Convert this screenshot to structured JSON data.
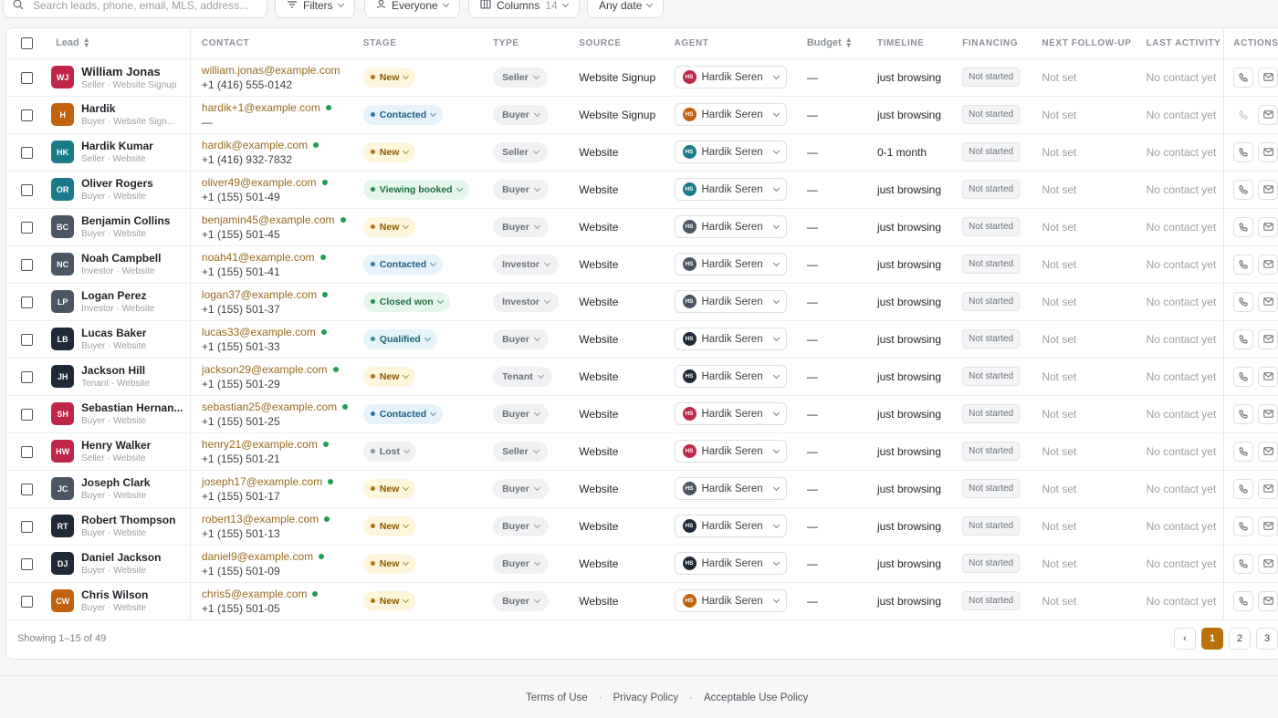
{
  "toolbar": {
    "search_placeholder": "Search leads, phone, email, MLS, address...",
    "filters_label": "Filters",
    "everyone_label": "Everyone",
    "columns_label": "Columns",
    "columns_count": "14",
    "date_label": "Any date"
  },
  "columns": {
    "lead": "Lead",
    "contact": "CONTACT",
    "stage": "STAGE",
    "type": "TYPE",
    "source": "SOURCE",
    "agent": "AGENT",
    "budget": "Budget",
    "timeline": "TIMELINE",
    "financing": "FINANCING",
    "next_followup": "NEXT FOLLOW-UP",
    "last_activity": "LAST ACTIVITY",
    "actions": "ACTIONS"
  },
  "stage_colors": {
    "New": {
      "bg": "#fdf6dc",
      "fg": "#8a5a00",
      "dot": "#b8720c"
    },
    "Contacted": {
      "bg": "#e6f3fb",
      "fg": "#1d5f86",
      "dot": "#2b7bb0"
    },
    "Viewing booked": {
      "bg": "#e5f6ec",
      "fg": "#1f6e42",
      "dot": "#22914f"
    },
    "Closed won": {
      "bg": "#e5f6ec",
      "fg": "#1f6e42",
      "dot": "#22914f"
    },
    "Qualified": {
      "bg": "#e3f5f8",
      "fg": "#1b6473",
      "dot": "#2b8fa3"
    },
    "Lost": {
      "bg": "#f0f1f3",
      "fg": "#6b7178",
      "dot": "#8a9099"
    }
  },
  "rows": [
    {
      "initials": "WJ",
      "avatar_color": "#c0264a",
      "name": "William Jonas",
      "sub": "Seller · Website Signup",
      "email": "william.jonas@example.com",
      "phone": "+1 (416) 555-0142",
      "verified": false,
      "stage": "New",
      "type": "Seller",
      "source": "Website Signup",
      "agent": "Hardik Seren",
      "agent_color": "#c0264a",
      "budget": "—",
      "timeline": "just browsing",
      "financing": "Not started",
      "followup": "Not set",
      "last": "No contact yet",
      "call_enabled": true
    },
    {
      "initials": "H",
      "avatar_color": "#c2620f",
      "name": "Hardik",
      "sub": "Buyer · Website Sign...",
      "email": "hardik+1@example.com",
      "phone": "—",
      "verified": true,
      "stage": "Contacted",
      "type": "Buyer",
      "source": "Website Signup",
      "agent": "Hardik Seren",
      "agent_color": "#c2620f",
      "budget": "—",
      "timeline": "just browsing",
      "financing": "Not started",
      "followup": "Not set",
      "last": "No contact yet",
      "call_enabled": false
    },
    {
      "initials": "HK",
      "avatar_color": "#1a7a8a",
      "name": "Hardik Kumar",
      "sub": "Seller · Website",
      "email": "hardik@example.com",
      "phone": "+1 (416) 932-7832",
      "verified": true,
      "stage": "New",
      "type": "Seller",
      "source": "Website",
      "agent": "Hardik Seren",
      "agent_color": "#1a7a8a",
      "budget": "—",
      "timeline": "0-1 month",
      "financing": "Not started",
      "followup": "Not set",
      "last": "No contact yet",
      "call_enabled": true
    },
    {
      "initials": "OR",
      "avatar_color": "#1a7a8a",
      "name": "Oliver Rogers",
      "sub": "Buyer · Website",
      "email": "oliver49@example.com",
      "phone": "+1 (155) 501-49",
      "verified": true,
      "stage": "Viewing booked",
      "type": "Buyer",
      "source": "Website",
      "agent": "Hardik Seren",
      "agent_color": "#1a7a8a",
      "budget": "—",
      "timeline": "just browsing",
      "financing": "Not started",
      "followup": "Not set",
      "last": "No contact yet",
      "call_enabled": true
    },
    {
      "initials": "BC",
      "avatar_color": "#4b5563",
      "name": "Benjamin Collins",
      "sub": "Buyer · Website",
      "email": "benjamin45@example.com",
      "phone": "+1 (155) 501-45",
      "verified": true,
      "stage": "New",
      "type": "Buyer",
      "source": "Website",
      "agent": "Hardik Seren",
      "agent_color": "#4b5563",
      "budget": "—",
      "timeline": "just browsing",
      "financing": "Not started",
      "followup": "Not set",
      "last": "No contact yet",
      "call_enabled": true
    },
    {
      "initials": "NC",
      "avatar_color": "#4b5563",
      "name": "Noah Campbell",
      "sub": "Investor · Website",
      "email": "noah41@example.com",
      "phone": "+1 (155) 501-41",
      "verified": true,
      "stage": "Contacted",
      "type": "Investor",
      "source": "Website",
      "agent": "Hardik Seren",
      "agent_color": "#4b5563",
      "budget": "—",
      "timeline": "just browsing",
      "financing": "Not started",
      "followup": "Not set",
      "last": "No contact yet",
      "call_enabled": true
    },
    {
      "initials": "LP",
      "avatar_color": "#4b5563",
      "name": "Logan Perez",
      "sub": "Investor · Website",
      "email": "logan37@example.com",
      "phone": "+1 (155) 501-37",
      "verified": true,
      "stage": "Closed won",
      "type": "Investor",
      "source": "Website",
      "agent": "Hardik Seren",
      "agent_color": "#4b5563",
      "budget": "—",
      "timeline": "just browsing",
      "financing": "Not started",
      "followup": "Not set",
      "last": "No contact yet",
      "call_enabled": true
    },
    {
      "initials": "LB",
      "avatar_color": "#1f2937",
      "name": "Lucas Baker",
      "sub": "Buyer · Website",
      "email": "lucas33@example.com",
      "phone": "+1 (155) 501-33",
      "verified": true,
      "stage": "Qualified",
      "type": "Buyer",
      "source": "Website",
      "agent": "Hardik Seren",
      "agent_color": "#1f2937",
      "budget": "—",
      "timeline": "just browsing",
      "financing": "Not started",
      "followup": "Not set",
      "last": "No contact yet",
      "call_enabled": true
    },
    {
      "initials": "JH",
      "avatar_color": "#1f2937",
      "name": "Jackson Hill",
      "sub": "Tenant · Website",
      "email": "jackson29@example.com",
      "phone": "+1 (155) 501-29",
      "verified": true,
      "stage": "New",
      "type": "Tenant",
      "source": "Website",
      "agent": "Hardik Seren",
      "agent_color": "#1f2937",
      "budget": "—",
      "timeline": "just browsing",
      "financing": "Not started",
      "followup": "Not set",
      "last": "No contact yet",
      "call_enabled": true
    },
    {
      "initials": "SH",
      "avatar_color": "#c0264a",
      "name": "Sebastian Hernan...",
      "sub": "Buyer · Website",
      "email": "sebastian25@example.com",
      "phone": "+1 (155) 501-25",
      "verified": true,
      "stage": "Contacted",
      "type": "Buyer",
      "source": "Website",
      "agent": "Hardik Seren",
      "agent_color": "#c0264a",
      "budget": "—",
      "timeline": "just browsing",
      "financing": "Not started",
      "followup": "Not set",
      "last": "No contact yet",
      "call_enabled": true
    },
    {
      "initials": "HW",
      "avatar_color": "#c0264a",
      "name": "Henry Walker",
      "sub": "Seller · Website",
      "email": "henry21@example.com",
      "phone": "+1 (155) 501-21",
      "verified": true,
      "stage": "Lost",
      "type": "Seller",
      "source": "Website",
      "agent": "Hardik Seren",
      "agent_color": "#c0264a",
      "budget": "—",
      "timeline": "just browsing",
      "financing": "Not started",
      "followup": "Not set",
      "last": "No contact yet",
      "call_enabled": true
    },
    {
      "initials": "JC",
      "avatar_color": "#4b5563",
      "name": "Joseph Clark",
      "sub": "Buyer · Website",
      "email": "joseph17@example.com",
      "phone": "+1 (155) 501-17",
      "verified": true,
      "stage": "New",
      "type": "Buyer",
      "source": "Website",
      "agent": "Hardik Seren",
      "agent_color": "#4b5563",
      "budget": "—",
      "timeline": "just browsing",
      "financing": "Not started",
      "followup": "Not set",
      "last": "No contact yet",
      "call_enabled": true
    },
    {
      "initials": "RT",
      "avatar_color": "#1f2937",
      "name": "Robert Thompson",
      "sub": "Buyer · Website",
      "email": "robert13@example.com",
      "phone": "+1 (155) 501-13",
      "verified": true,
      "stage": "New",
      "type": "Buyer",
      "source": "Website",
      "agent": "Hardik Seren",
      "agent_color": "#1f2937",
      "budget": "—",
      "timeline": "just browsing",
      "financing": "Not started",
      "followup": "Not set",
      "last": "No contact yet",
      "call_enabled": true
    },
    {
      "initials": "DJ",
      "avatar_color": "#1f2937",
      "name": "Daniel Jackson",
      "sub": "Buyer · Website",
      "email": "daniel9@example.com",
      "phone": "+1 (155) 501-09",
      "verified": true,
      "stage": "New",
      "type": "Buyer",
      "source": "Website",
      "agent": "Hardik Seren",
      "agent_color": "#1f2937",
      "budget": "—",
      "timeline": "just browsing",
      "financing": "Not started",
      "followup": "Not set",
      "last": "No contact yet",
      "call_enabled": true
    },
    {
      "initials": "CW",
      "avatar_color": "#c2620f",
      "name": "Chris Wilson",
      "sub": "Buyer · Website",
      "email": "chris5@example.com",
      "phone": "+1 (155) 501-05",
      "verified": true,
      "stage": "New",
      "type": "Buyer",
      "source": "Website",
      "agent": "Hardik Seren",
      "agent_color": "#c2620f",
      "budget": "—",
      "timeline": "just browsing",
      "financing": "Not started",
      "followup": "Not set",
      "last": "No contact yet",
      "call_enabled": true
    }
  ],
  "agent_initials": "HS",
  "pagination": {
    "showing": "Showing 1–15 of 49",
    "prev": "‹",
    "pages": [
      "1",
      "2",
      "3"
    ],
    "active": "1"
  },
  "footer": {
    "terms": "Terms of Use",
    "privacy": "Privacy Policy",
    "aup": "Acceptable Use Policy",
    "sep": "·"
  },
  "accent_color": "#b8720c"
}
